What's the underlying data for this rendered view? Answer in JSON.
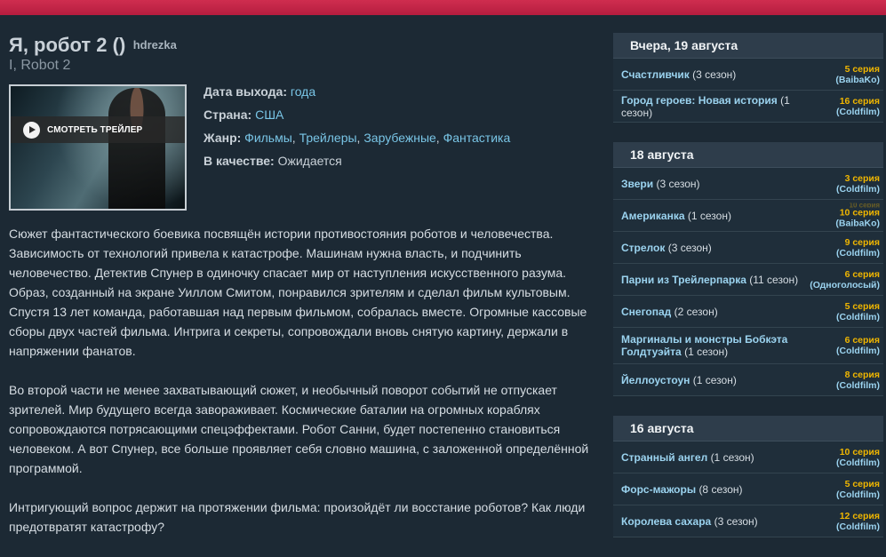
{
  "movie": {
    "title": "Я, робот 2 ()",
    "source": "hdrezka",
    "original_title": "I, Robot 2",
    "trailer_label": "СМОТРЕТЬ ТРЕЙЛЕР",
    "info": {
      "release_label": "Дата выхода:",
      "release_value": "года",
      "country_label": "Страна:",
      "country_value": "США",
      "genre_label": "Жанр:",
      "genres": [
        "Фильмы",
        "Трейлеры",
        "Зарубежные",
        "Фантастика"
      ],
      "quality_label": "В качестве:",
      "quality_value": "Ожидается"
    },
    "description": [
      "Сюжет фантастического боевика посвящён истории противостояния роботов и человечества. Зависимость от технологий привела к катастрофе. Машинам нужна власть, и подчинить человечество. Детектив Спунер в одиночку спасает мир от наступления искусственного разума. Образ, созданный на экране Уиллом Смитом, понравился зрителям и сделал фильм культовым. Спустя 13 лет команда, работавшая над первым фильмом, собралась вместе. Огромные кассовые сборы двух частей фильма. Интрига и секреты, сопровождали вновь снятую картину, держали в напряжении фанатов.",
      "Во второй части не менее захватывающий сюжет, и необычный поворот событий не отпускает зрителей. Мир будущего всегда завораживает. Космические баталии на огромных кораблях сопровождаются потрясающими спецэффектами. Робот Санни, будет постепенно становиться человеком. А вот Спунер, все больше проявляет себя словно машина, с заложенной определённой программой.",
      "Интригующий вопрос держит на протяжении фильма: произойдёт ли восстание роботов? Как люди предотвратят катастрофу?"
    ]
  },
  "sidebar": {
    "blocks": [
      {
        "date": "Вчера, 19 августа",
        "items": [
          {
            "name": "Счастливчик",
            "season": "(3 сезон)",
            "episode": "5 серия",
            "studio": "(BaibaKo)"
          },
          {
            "name": "Город героев: Новая история",
            "season": "(1 сезон)",
            "episode": "16 серия",
            "studio": "(Coldfilm)"
          }
        ]
      },
      {
        "date": "18 августа",
        "items": [
          {
            "name": "Звери",
            "season": "(3 сезон)",
            "episode": "3 серия",
            "studio": "(Coldfilm)"
          },
          {
            "name": "Американка",
            "season": "(1 сезон)",
            "episode_prev": "10 серия",
            "episode": "10 серия",
            "studio": "(BaibaKo)"
          },
          {
            "name": "Стрелок",
            "season": "(3 сезон)",
            "episode": "9 серия",
            "studio": "(Coldfilm)"
          },
          {
            "name": "Парни из Трейлерпарка",
            "season": "(11 сезон)",
            "episode": "6 серия",
            "studio": "(Одноголосый)"
          },
          {
            "name": "Снегопад",
            "season": "(2 сезон)",
            "episode": "5 серия",
            "studio": "(Coldfilm)"
          },
          {
            "name": "Маргиналы и монстры Бобкэта Голдтуэйта",
            "season": "(1 сезон)",
            "episode": "6 серия",
            "studio": "(Coldfilm)"
          },
          {
            "name": "Йеллоустоун",
            "season": "(1 сезон)",
            "episode": "8 серия",
            "studio": "(Coldfilm)"
          }
        ]
      },
      {
        "date": "16 августа",
        "items": [
          {
            "name": "Странный ангел",
            "season": "(1 сезон)",
            "episode": "10 серия",
            "studio": "(Coldfilm)"
          },
          {
            "name": "Форс-мажоры",
            "season": "(8 сезон)",
            "episode": "5 серия",
            "studio": "(Coldfilm)"
          },
          {
            "name": "Королева сахара",
            "season": "(3 сезон)",
            "episode": "12 серия",
            "studio": "(Coldfilm)"
          }
        ]
      }
    ]
  },
  "colors": {
    "accent_bar": "#c8264a",
    "link": "#79c5e6",
    "episode": "#f0b600",
    "background": "#1c2934"
  }
}
